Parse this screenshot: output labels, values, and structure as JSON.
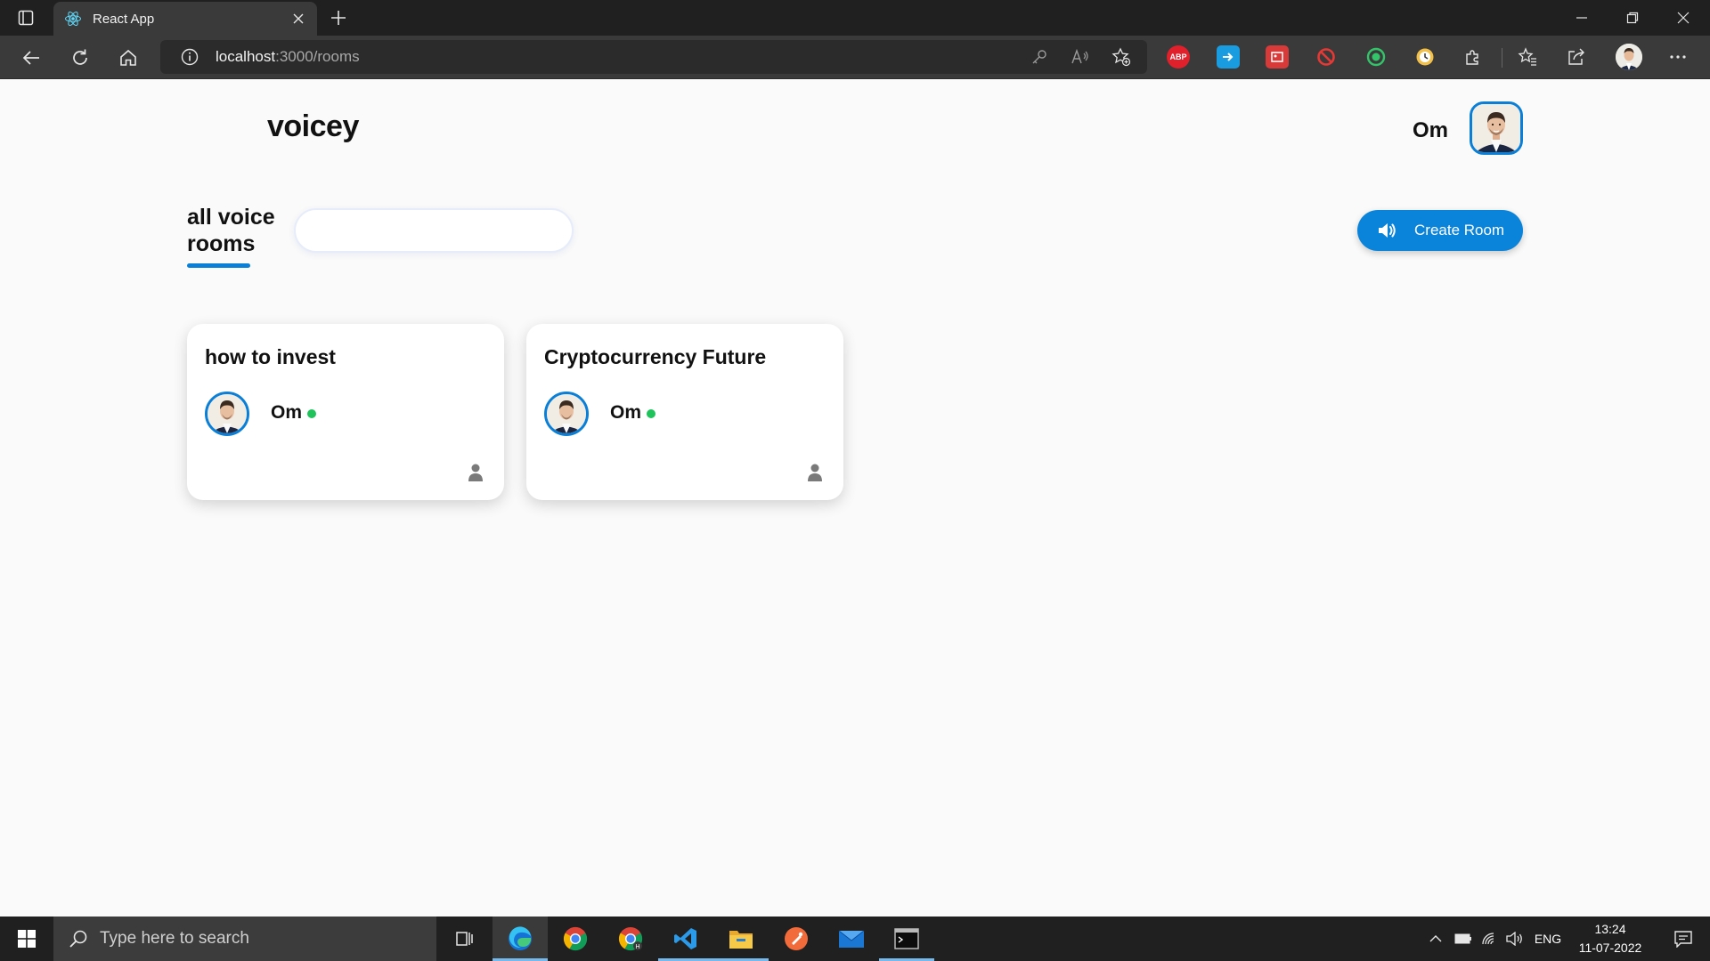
{
  "browser": {
    "tab_title": "React App",
    "url_host": "localhost",
    "url_rest": ":3000/rooms",
    "extensions": [
      "adblock-plus",
      "send-tab",
      "gallery-ext",
      "block-ext",
      "target-ext",
      "clock-ext",
      "extensions-puzzle"
    ]
  },
  "header": {
    "brand": "voicey",
    "user_name": "Om"
  },
  "toolbar": {
    "heading": "all voice rooms",
    "search_placeholder": "",
    "create_label": "Create Room"
  },
  "rooms": [
    {
      "topic": "how to invest",
      "speaker": "Om",
      "online": true
    },
    {
      "topic": "Cryptocurrency Future",
      "speaker": "Om",
      "online": true
    }
  ],
  "taskbar": {
    "search_placeholder": "Type here to search",
    "lang": "ENG",
    "time": "13:24",
    "date": "11-07-2022"
  },
  "colors": {
    "accent": "#0a83db",
    "online": "#20c35b"
  }
}
